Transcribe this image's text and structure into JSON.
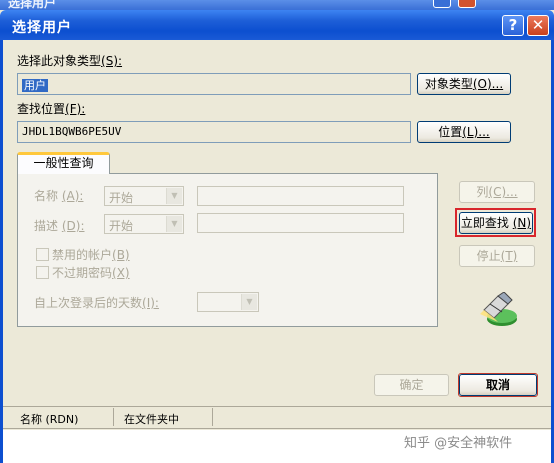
{
  "background_window": {
    "title": "选择用户"
  },
  "window": {
    "title": "选择用户",
    "help_label": "?",
    "close_label": "✕"
  },
  "object_type": {
    "label": "选择此对象类型",
    "hotkey": "(S):",
    "value": "用户",
    "button_label": "对象类型",
    "button_hotkey": "(O)..."
  },
  "location": {
    "label": "查找位置",
    "hotkey": "(F):",
    "value": "JHDL1BQWB6PE5UV",
    "button_label": "位置",
    "button_hotkey": "(L)..."
  },
  "tab": {
    "label": "一般性查询"
  },
  "query": {
    "name_label": "名称",
    "name_hotkey": "(A):",
    "name_mode": "开始",
    "desc_label": "描述",
    "desc_hotkey": "(D):",
    "desc_mode": "开始",
    "disabled_accounts_label": "禁用的帐户",
    "disabled_accounts_hotkey": "(B)",
    "non_expiring_pw_label": "不过期密码",
    "non_expiring_pw_hotkey": "(X)",
    "days_since_login_label": "自上次登录后的天数",
    "days_since_login_hotkey": "(I):"
  },
  "side_buttons": {
    "columns_label": "列",
    "columns_hotkey": "(C)...",
    "find_now_label": "立即查找",
    "find_now_hotkey": "(N)",
    "stop_label": "停止",
    "stop_hotkey": "(T)"
  },
  "footer": {
    "ok_label": "确定",
    "cancel_label": "取消"
  },
  "results": {
    "col_name": "名称 (RDN)",
    "col_folder": "在文件夹中"
  },
  "watermark": "知乎 @安全神软件",
  "colors": {
    "titlebar": "#0c4fd0",
    "dialog_bg": "#ece9d8",
    "highlight": "#d8262c",
    "tab_accent": "#ffc83c"
  }
}
